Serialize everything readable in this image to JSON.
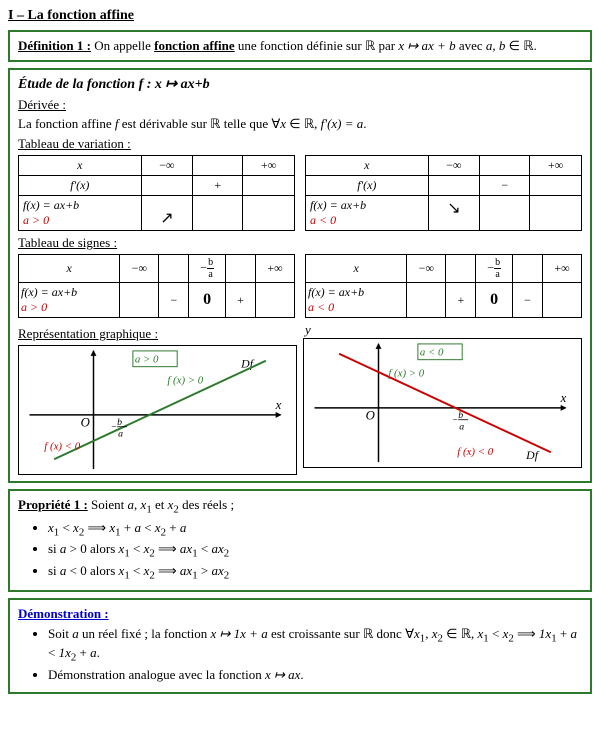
{
  "page": {
    "section_title": "I – La fonction affine",
    "definition": {
      "label": "Définition 1 :",
      "text": "On appelle",
      "highlighted": "fonction affine",
      "text2": "une fonction définie sur",
      "R": "ℝ",
      "text3": "par",
      "formula": "x ↦ ax + b",
      "text4": "avec",
      "condition": "a, b ∈ ℝ."
    },
    "study": {
      "title": "Étude de la fonction f : x ↦ ax+b",
      "derivative_title": "Dérivée :",
      "derivative_text": "La fonction affine f est dérivable sur ℝ telle que ∀x ∈ ℝ, f'(x) = a.",
      "variation_title": "Tableau de variation :",
      "sign_title": "Tableau de signes :",
      "graph_title": "Représentation graphique :",
      "y_label": "y"
    },
    "property": {
      "label": "Propriété 1 :",
      "text": "Soient a, x₁ et x₂ des réels ;",
      "bullets": [
        "x₁ < x₂ ⟹ x₁ + a < x₂ + a",
        "si a > 0 alors x₁ < x₂ ⟹ ax₁ < ax₂",
        "si a < 0 alors x₁ < x₂ ⟹ ax₁ > ax₂"
      ]
    },
    "demonstration": {
      "label": "Démonstration :",
      "bullets": [
        "Soit a un réel fixé ; la fonction x ↦ 1x + a est croissante sur ℝ donc ∀x₁, x₂ ∈ ℝ, x₁ < x₂ ⟹ 1x₁ + a < 1x₂ + a.",
        "Démonstration analogue avec la fonction x ↦ ax."
      ]
    }
  }
}
